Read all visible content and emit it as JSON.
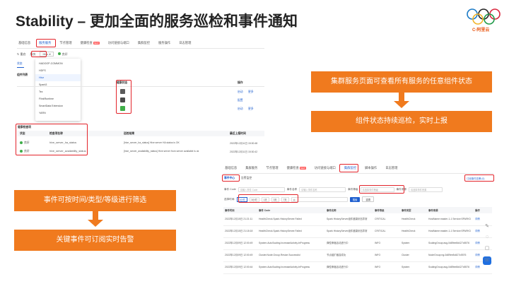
{
  "slide": {
    "title": "Stability – 更加全面的服务巡检和事件通知",
    "logo_text": "C-阿里云"
  },
  "shot1": {
    "tabs": [
      "基础信息",
      "服务服务",
      "节点管理",
      "健康检查",
      "访问链接与端口",
      "集群监控",
      "服务操作",
      "日志管理"
    ],
    "new_badge": "NEW",
    "toolbar": {
      "restart": "重启",
      "service_label": "服务",
      "selected_service": "Hive",
      "status": "良好"
    },
    "subtabs": {
      "status": "状态"
    },
    "section_title": "组件列表",
    "dropdown_items": [
      "HADOOP-COMMON",
      "HDFS",
      "Hive",
      "Spark3",
      "Tez",
      "FlinkRuntime",
      "SmartData Extension",
      "YARN"
    ],
    "selected_index": 2,
    "col_health": "健康状态",
    "col_op": "操作",
    "op_start": "启动",
    "op_more": "更多",
    "op_config": "配置",
    "health_title": "健康检查项",
    "health_cols": [
      "状态",
      "检查项名称",
      "巡检结果",
      "最近上报时间"
    ],
    "health_rows": [
      [
        "良好",
        "hive_server_ha_status",
        "[hive_server_ha_status] Hive server HA status is OK",
        "2022年12月11日 15:30:48"
      ],
      [
        "良好",
        "hive_server_availability_status",
        "[hive_server_availability_status] Hive server from server available is ok",
        "2022年12月11日 15:30:42"
      ]
    ],
    "status_colors": [
      "#5a5a5a",
      "#4a4a4a",
      "#3fae49"
    ]
  },
  "shot2": {
    "tabs": [
      "基础信息",
      "集群服务",
      "节点管理",
      "健康检查",
      "访问链接与端口",
      "集群监控",
      "脚本操作",
      "日志管理"
    ],
    "new_badge": "NEW",
    "subtabs": [
      "事件中心",
      "告警监控"
    ],
    "subscribe_link": "订阅事件告警 (0)",
    "filters": {
      "event_code_label": "事件 Code",
      "event_code_ph": "请输入事件 Code",
      "event_name_label": "事件名称",
      "event_name_ph": "请输入事件名称",
      "level_label": "事件等级",
      "level_ph": "请选择事件等级",
      "source_label": "事件来源",
      "source_ph": "请选择事件来源",
      "time_label": "选择时间:",
      "time_options": [
        "1小时",
        "3小时",
        "1天",
        "3天",
        "7天"
      ],
      "search": "搜索",
      "reset": "重置"
    },
    "table": {
      "headers": [
        "事件时间",
        "事件 Code",
        "事件名称",
        "事件等级",
        "事件类型",
        "事件来源",
        "操作"
      ],
      "rows": [
        [
          "2022年12月15日 21:21:11",
          "HealthCheck.Spark.HistoryServer.Failed",
          "Spark HistoryServer组件健康状态异常",
          "CRITICAL",
          "HealthCheck",
          "HostName:master-1-1 Service:SPARK3",
          "详情"
        ],
        [
          "2022年12月15日 21:18:18",
          "HealthCheck.Spark.HistoryServer.Failed",
          "Spark HistoryServer组件健康状态异常",
          "CRITICAL",
          "HealthCheck",
          "HostName:master-1-1 Service:SPARK3",
          "详情"
        ],
        [
          "2022年12月09日 12:00:49",
          "System.AutoScaling.IncreaseActivity.InProgress",
          "弹性伸缩活动进行中",
          "INFO",
          "System",
          "ScalingGroup:asg-0d89ee8d427c5576",
          "详情"
        ],
        [
          "2022年12月09日 12:00:49",
          "Cluster.Node.Group.Resize.Successful",
          "节点组扩缩容成功",
          "INFO",
          "Cluster",
          "NodeGroup:ng-0d89ee8d427c5576",
          "详情"
        ],
        [
          "2022年12月09日 12:00:44",
          "System.AutoScaling.IncreaseActivity.InProgress",
          "弹性伸缩活动进行中",
          "INFO",
          "System",
          "ScalingGroup:asg-0d89ee8d427c5576",
          "详情"
        ]
      ]
    }
  },
  "callouts": {
    "right_top": "集群服务页面可查看所有服务的任意组件状态",
    "right_bottom": "组件状态持续巡检，实时上报",
    "left_top": "事件可按时间/类型/等级进行筛选",
    "left_bottom": "关键事件可订阅实时告警"
  },
  "colors": {
    "accent_orange": "#f07a1e",
    "highlight_red": "#e3242b",
    "link_blue": "#1f5fcf"
  }
}
